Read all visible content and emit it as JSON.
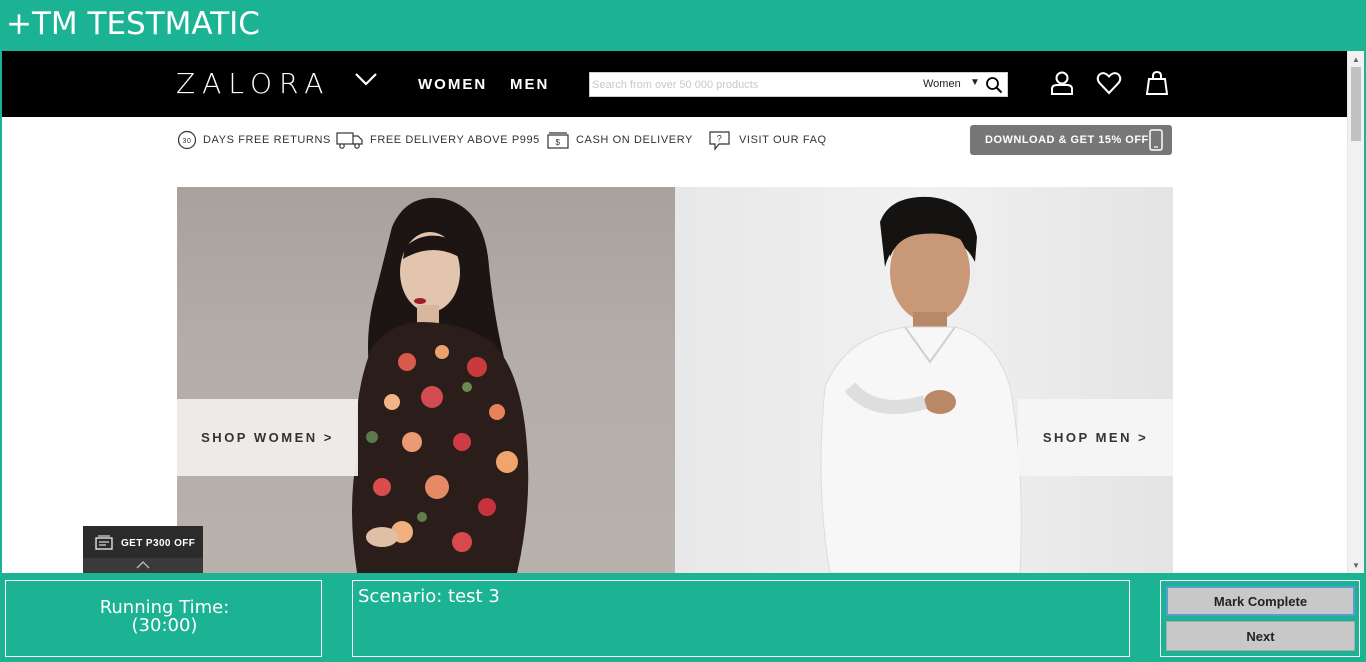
{
  "app": {
    "title": "+TM TESTMATIC"
  },
  "zalora": {
    "logo": "ZALORA",
    "nav": {
      "women": "WOMEN",
      "men": "MEN"
    },
    "search": {
      "placeholder": "Search from over 50 000 products",
      "category": "Women",
      "caret": "▼"
    },
    "benefits": {
      "returns_badge": "30",
      "returns": "DAYS FREE RETURNS",
      "delivery": "FREE DELIVERY ABOVE P995",
      "cod": "CASH ON DELIVERY",
      "faq": "VISIT OUR FAQ"
    },
    "download": "DOWNLOAD & GET 15% OFF",
    "hero": {
      "shop_women": "SHOP WOMEN >",
      "shop_men": "SHOP MEN >"
    },
    "promo": "GET P300 OFF"
  },
  "panel": {
    "running_time_label": "Running Time:",
    "running_time_value": "(30:00)",
    "scenario": "Scenario: test 3",
    "mark_complete": "Mark Complete",
    "next": "Next"
  },
  "colors": {
    "testmatic_green": "#1bb394",
    "zalora_black": "#000000",
    "download_gray": "#777777"
  }
}
